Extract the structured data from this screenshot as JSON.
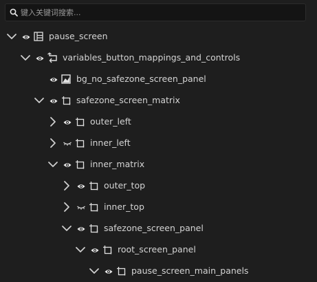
{
  "search": {
    "placeholder": "键入关键词搜索..."
  },
  "tree": [
    {
      "label": "pause_screen",
      "expanded": true,
      "has_children": true,
      "visible": true,
      "icon": "panel-grid-icon"
    },
    {
      "label": "variables_button_mappings_and_controls",
      "expanded": true,
      "has_children": true,
      "visible": true,
      "icon": "loop-arrow-icon"
    },
    {
      "label": "bg_no_safezone_screen_panel",
      "expanded": false,
      "has_children": false,
      "visible": true,
      "icon": "image-icon"
    },
    {
      "label": "safezone_screen_matrix",
      "expanded": true,
      "has_children": true,
      "visible": true,
      "icon": "frame-icon"
    },
    {
      "label": "outer_left",
      "expanded": false,
      "has_children": true,
      "visible": true,
      "icon": "frame-icon"
    },
    {
      "label": "inner_left",
      "expanded": false,
      "has_children": true,
      "visible": false,
      "icon": "frame-icon"
    },
    {
      "label": "inner_matrix",
      "expanded": true,
      "has_children": true,
      "visible": true,
      "icon": "frame-icon"
    },
    {
      "label": "outer_top",
      "expanded": false,
      "has_children": true,
      "visible": true,
      "icon": "frame-icon"
    },
    {
      "label": "inner_top",
      "expanded": false,
      "has_children": true,
      "visible": false,
      "icon": "frame-icon"
    },
    {
      "label": "safezone_screen_panel",
      "expanded": true,
      "has_children": true,
      "visible": true,
      "icon": "frame-icon"
    },
    {
      "label": "root_screen_panel",
      "expanded": true,
      "has_children": true,
      "visible": true,
      "icon": "frame-icon"
    },
    {
      "label": "pause_screen_main_panels",
      "expanded": true,
      "has_children": true,
      "visible": true,
      "icon": "frame-icon"
    }
  ]
}
